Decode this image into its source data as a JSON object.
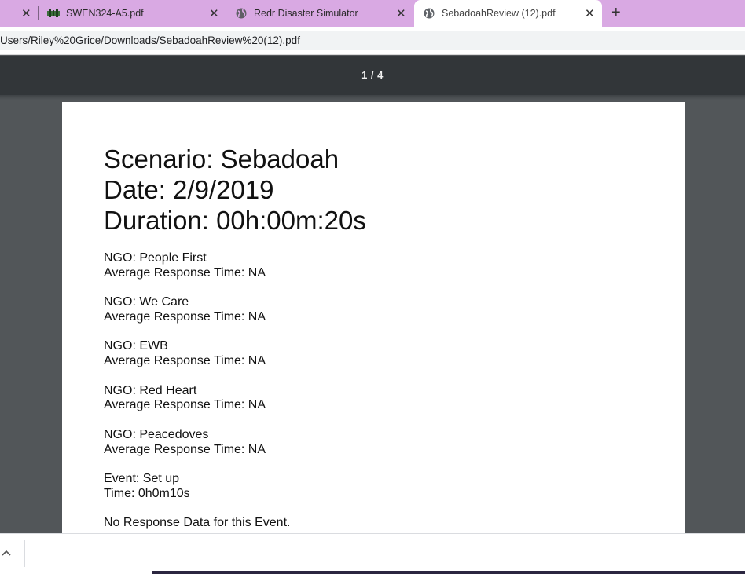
{
  "tabs": [
    {
      "label": "",
      "close": "✕"
    },
    {
      "label": "SWEN324-A5.pdf",
      "close": "✕",
      "icon": "green-favicon-icon"
    },
    {
      "label": "Redr Disaster Simulator",
      "close": "✕",
      "icon": "globe-icon"
    },
    {
      "label": "SebadoahReview (12).pdf",
      "close": "✕",
      "icon": "globe-icon",
      "active": true
    }
  ],
  "new_tab": "+",
  "address": {
    "url": "Users/Riley%20Grice/Downloads/SebadoahReview%20(12).pdf"
  },
  "pdf_toolbar": {
    "page_counter": "1 / 4"
  },
  "document": {
    "headings": [
      "Scenario: Sebadoah",
      "Date: 2/9/2019",
      "Duration: 00h:00m:20s"
    ],
    "ngos": [
      {
        "name_line": "NGO: People First",
        "response_line": "Average Response Time: NA"
      },
      {
        "name_line": "NGO: We Care",
        "response_line": "Average Response Time: NA"
      },
      {
        "name_line": "NGO: EWB",
        "response_line": "Average Response Time: NA"
      },
      {
        "name_line": "NGO: Red Heart",
        "response_line": "Average Response Time: NA"
      },
      {
        "name_line": "NGO: Peacedoves",
        "response_line": "Average Response Time: NA"
      }
    ],
    "event": {
      "name_line": "Event: Set up",
      "time_line": "Time: 0h0m10s",
      "note": "No Response Data for this Event."
    }
  },
  "download_bar": {
    "chevron": "^"
  },
  "colors": {
    "tabstrip": "#d9a9e3",
    "toolbar": "#323639",
    "viewer_bg": "#525659"
  }
}
